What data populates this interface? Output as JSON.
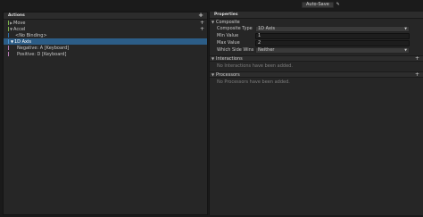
{
  "toolbar": {
    "autosave_label": "Auto-Save",
    "tool_icon": "wrench-icon"
  },
  "actions_panel": {
    "title": "Actions",
    "tree": [
      {
        "label": "Move",
        "level": 1,
        "expanded": false,
        "color": "#79b04a"
      },
      {
        "label": "Accel",
        "level": 1,
        "expanded": true,
        "color": "#79b04a"
      },
      {
        "label": "<No Binding>",
        "level": 2,
        "color": "#2f6fa8"
      },
      {
        "label": "1D Axis",
        "level": 2,
        "expanded": true,
        "selected": true,
        "color": "#2f6fa8"
      },
      {
        "label": "Negative: A [Keyboard]",
        "level": 3,
        "color": "#b679b4"
      },
      {
        "label": "Positive: D [Keyboard]",
        "level": 3,
        "color": "#b679b4"
      }
    ]
  },
  "properties_panel": {
    "title": "Properties",
    "composite": {
      "header": "Composite",
      "fields": [
        {
          "label": "Composite Type",
          "value": "1D Axis",
          "type": "dropdown"
        },
        {
          "label": "Min Value",
          "value": "1",
          "type": "number"
        },
        {
          "label": "Max Value",
          "value": "2",
          "type": "number"
        },
        {
          "label": "Which Side Wins",
          "value": "Neither",
          "type": "dropdown"
        }
      ]
    },
    "interactions": {
      "header": "Interactions",
      "empty_message": "No Interactions have been added."
    },
    "processors": {
      "header": "Processors",
      "empty_message": "No Processors have been added."
    }
  }
}
